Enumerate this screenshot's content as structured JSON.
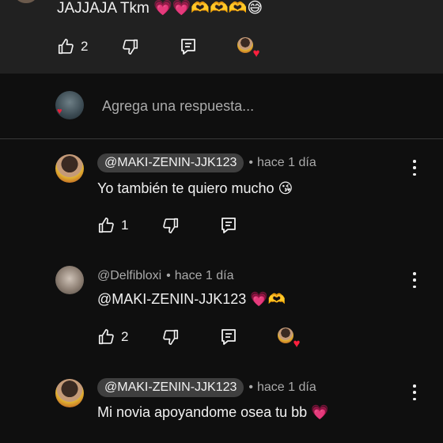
{
  "top_comment": {
    "text": "JAJJAJA Tkm 💗💗🫶🫶🫶😅",
    "likes": "2"
  },
  "reply_box": {
    "placeholder": "Agrega una respuesta..."
  },
  "replies": [
    {
      "handle": "@MAKI-ZENIN-JJK123",
      "time": "hace 1 día",
      "text": "Yo también te quiero mucho 😘",
      "likes": "1",
      "creator_heart": false
    },
    {
      "handle": "@Delfibloxi",
      "time": "hace 1 día",
      "text": "@MAKI-ZENIN-JJK123  💗🫶",
      "likes": "2",
      "creator_heart": true
    },
    {
      "handle": "@MAKI-ZENIN-JJK123",
      "time": "hace 1 día",
      "text": "Mi novia apoyandome osea tu bb 💗"
    }
  ],
  "separator": "•",
  "colors": {
    "background": "#0f0f0f",
    "highlight_block": "#212121",
    "pill": "#3f3f3f",
    "secondary_text": "#aaaaaa",
    "heart": "#ff1f3d"
  }
}
